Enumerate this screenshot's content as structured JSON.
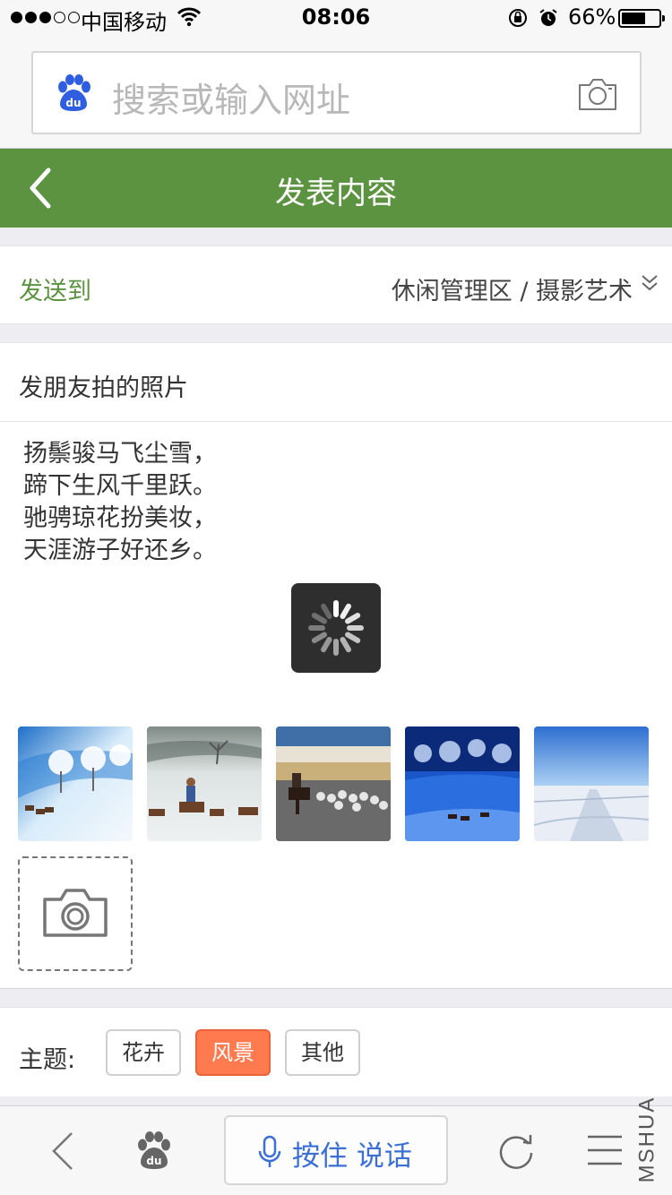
{
  "status_bar": {
    "carrier": "中国移动",
    "time": "08:06",
    "battery_percent": "66%",
    "battery_level": 0.66,
    "signal_strength": 3,
    "signal_max": 5
  },
  "browser": {
    "search_placeholder": "搜索或输入网址"
  },
  "header": {
    "title": "发表内容"
  },
  "target": {
    "label": "发送到",
    "value": "休闲管理区 / 摄影艺术"
  },
  "post": {
    "title": "发朋友拍的照片",
    "body_lines": [
      "扬鬃骏马飞尘雪，",
      "蹄下生风千里跃。",
      "驰骋琼花扮美妆，",
      "天涯游子好还乡。"
    ]
  },
  "photos": [
    {
      "icon": "winter-horses-photo"
    },
    {
      "icon": "rider-horses-photo"
    },
    {
      "icon": "herder-sheep-photo"
    },
    {
      "icon": "blue-forest-photo"
    },
    {
      "icon": "snow-road-photo"
    }
  ],
  "topics": {
    "label": "主题:",
    "options": [
      {
        "label": "花卉",
        "active": false
      },
      {
        "label": "风景",
        "active": true
      },
      {
        "label": "其他",
        "active": false
      }
    ]
  },
  "toolbar": {
    "voice_label": "按住 说话"
  },
  "watermark": "MSHUA",
  "colors": {
    "header_green": "#5c9340",
    "active_topic": "#ff7a4f",
    "voice_blue": "#3b6fd6"
  }
}
